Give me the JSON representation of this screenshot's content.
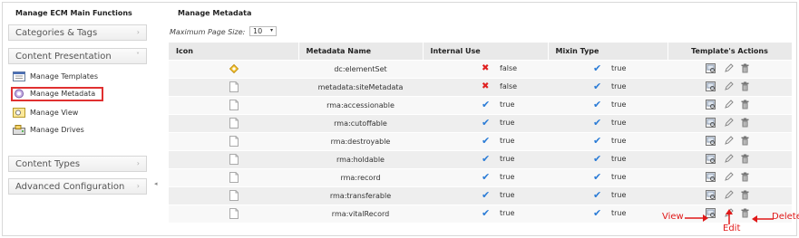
{
  "left_panel": {
    "title": "Manage ECM Main Functions",
    "sections": [
      {
        "label": "Categories & Tags",
        "chevron": "›"
      },
      {
        "label": "Content Presentation",
        "chevron": "˅"
      },
      {
        "label": "Content Types",
        "chevron": "›"
      },
      {
        "label": "Advanced Configuration",
        "chevron": "›"
      }
    ],
    "items": [
      {
        "label": "Manage Templates",
        "icon": "templates-icon"
      },
      {
        "label": "Manage Metadata",
        "icon": "metadata-icon",
        "selected": true
      },
      {
        "label": "Manage View",
        "icon": "view-icon"
      },
      {
        "label": "Manage Drives",
        "icon": "drives-icon"
      }
    ],
    "collapse_glyph": "◂"
  },
  "main": {
    "title": "Manage Metadata",
    "page_size_label": "Maximum Page Size:",
    "page_size_value": "10",
    "page_size_arrow": "▾",
    "columns": [
      "Icon",
      "Metadata Name",
      "Internal Use",
      "Mixin Type",
      "Template's Actions"
    ],
    "rows": [
      {
        "icon": "element-set-icon",
        "name": "dc:elementSet",
        "internal_use": "false",
        "mixin_type": "true"
      },
      {
        "icon": "document-icon",
        "name": "metadata:siteMetadata",
        "internal_use": "false",
        "mixin_type": "true"
      },
      {
        "icon": "document-icon",
        "name": "rma:accessionable",
        "internal_use": "true",
        "mixin_type": "true"
      },
      {
        "icon": "document-icon",
        "name": "rma:cutoffable",
        "internal_use": "true",
        "mixin_type": "true"
      },
      {
        "icon": "document-icon",
        "name": "rma:destroyable",
        "internal_use": "true",
        "mixin_type": "true"
      },
      {
        "icon": "document-icon",
        "name": "rma:holdable",
        "internal_use": "true",
        "mixin_type": "true"
      },
      {
        "icon": "document-icon",
        "name": "rma:record",
        "internal_use": "true",
        "mixin_type": "true"
      },
      {
        "icon": "document-icon",
        "name": "rma:transferable",
        "internal_use": "true",
        "mixin_type": "true"
      },
      {
        "icon": "document-icon",
        "name": "rma:vitalRecord",
        "internal_use": "true",
        "mixin_type": "true"
      }
    ]
  },
  "annotations": {
    "view": "View",
    "edit": "Edit",
    "delete": "Delete"
  },
  "colors": {
    "annotation": "#e01818",
    "check": "#2a7bd6",
    "cross": "#e02020",
    "selection_border": "#e03030"
  }
}
